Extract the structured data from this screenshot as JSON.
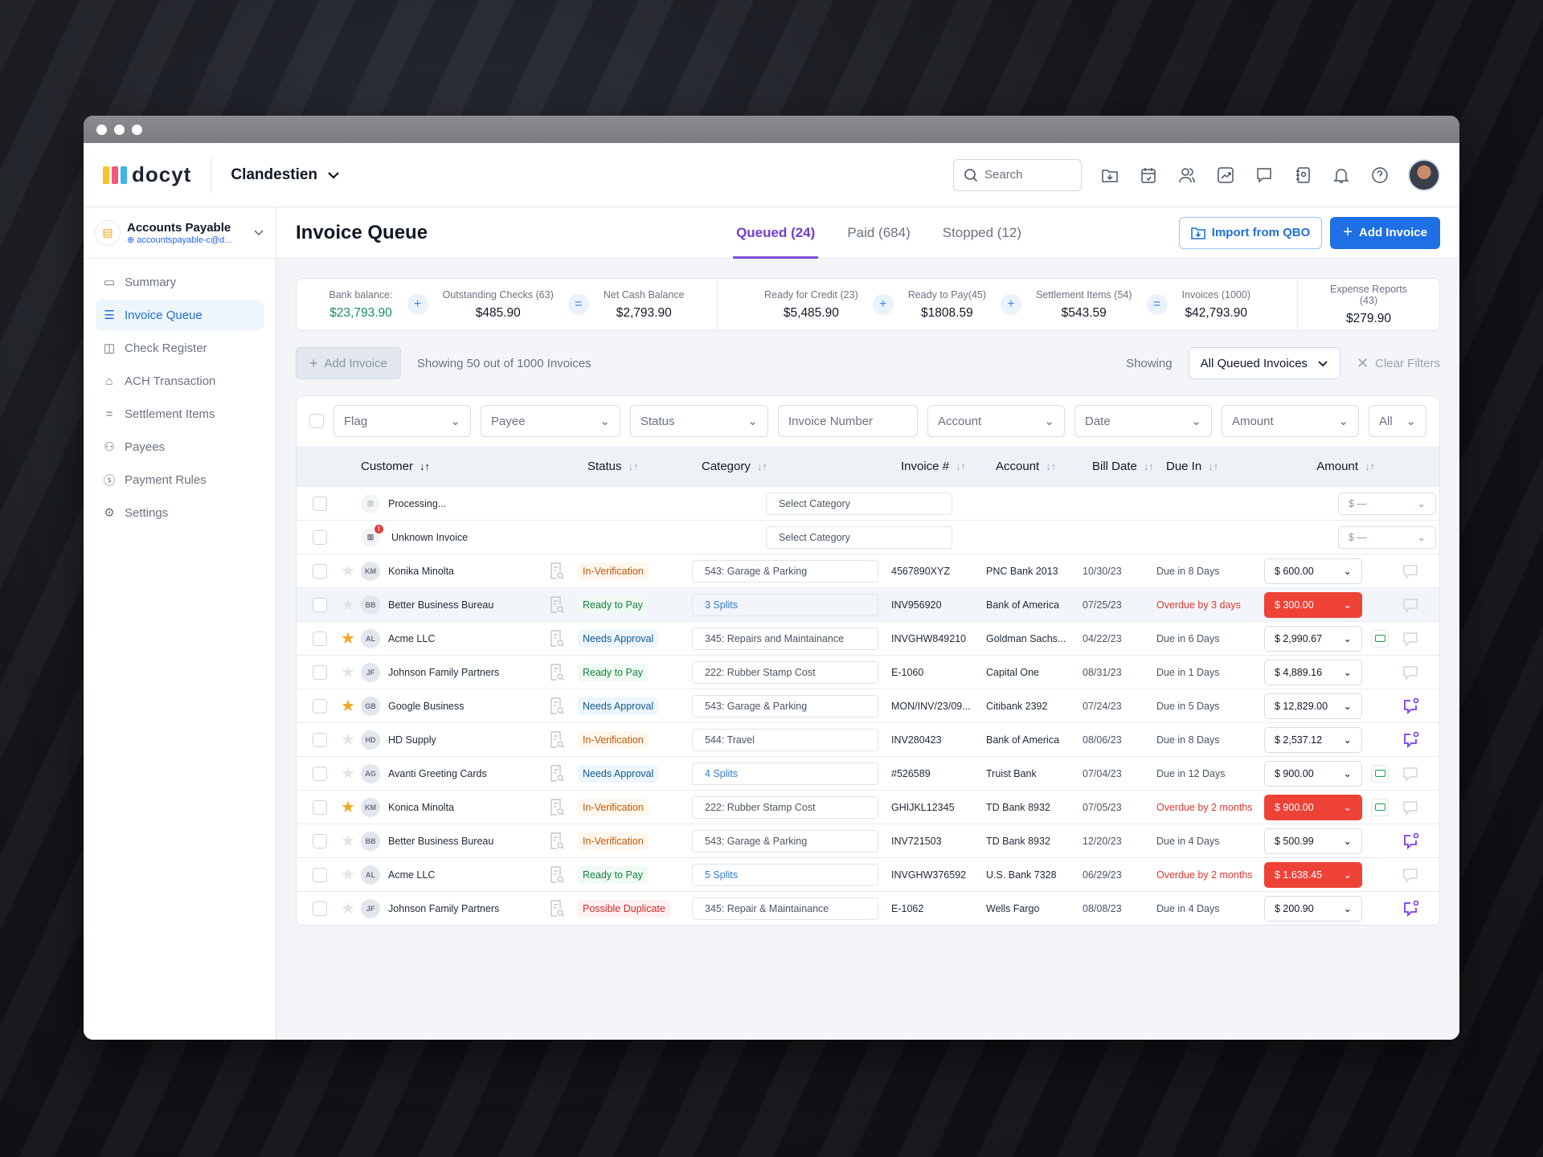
{
  "app": {
    "logo_text": "docyt",
    "company": "Clandestien",
    "search_placeholder": "Search"
  },
  "account": {
    "name": "Accounts Payable",
    "email": "accountspayable-c@d..."
  },
  "sidebar": {
    "items": [
      {
        "label": "Summary",
        "icon": "presentation-icon"
      },
      {
        "label": "Invoice Queue",
        "icon": "list-icon",
        "active": true
      },
      {
        "label": "Check Register",
        "icon": "book-icon"
      },
      {
        "label": "ACH Transaction",
        "icon": "bank-icon"
      },
      {
        "label": "Settlement Items",
        "icon": "equals-icon"
      },
      {
        "label": "Payees",
        "icon": "users-icon"
      },
      {
        "label": "Payment Rules",
        "icon": "dollar-circle-icon"
      },
      {
        "label": "Settings",
        "icon": "gear-icon"
      }
    ]
  },
  "header": {
    "title": "Invoice Queue",
    "tabs": [
      {
        "label": "Queued (24)",
        "active": true
      },
      {
        "label": "Paid (684)"
      },
      {
        "label": "Stopped (12)"
      }
    ],
    "import_label": "Import from QBO",
    "add_label": "Add Invoice"
  },
  "summary": {
    "bank_balance": {
      "label": "Bank balance:",
      "value": "$23,793.90"
    },
    "outstanding": {
      "label": "Outstanding Checks (63)",
      "value": "$485.90"
    },
    "net_cash": {
      "label": "Net Cash Balance",
      "value": "$2,793.90"
    },
    "ready_credit": {
      "label": "Ready for Credit (23)",
      "value": "$5,485.90"
    },
    "ready_pay": {
      "label": "Ready to Pay(45)",
      "value": "$1808.59"
    },
    "settlement": {
      "label": "Settlement Items (54)",
      "value": "$543.59"
    },
    "invoices": {
      "label": "Invoices (1000)",
      "value": "$42,793.90"
    },
    "expense": {
      "label": "Expense Reports (43)",
      "value": "$279.90"
    }
  },
  "toolbar": {
    "add_label": "Add Invoice",
    "showing_text": "Showing 50 out of 1000 Invoices",
    "showing_label": "Showing",
    "view_select": "All Queued Invoices",
    "clear_label": "Clear Filters"
  },
  "filters": {
    "flag": "Flag",
    "payee": "Payee",
    "status": "Status",
    "invoice_number": "Invoice Number",
    "account": "Account",
    "date": "Date",
    "amount": "Amount",
    "all": "All"
  },
  "columns": {
    "customer": "Customer",
    "status": "Status",
    "category": "Category",
    "invoice": "Invoice #",
    "account": "Account",
    "bill_date": "Bill Date",
    "due_in": "Due In",
    "amount": "Amount"
  },
  "pending_rows": [
    {
      "name": "Processing...",
      "category": "Select Category",
      "amount": "$ —"
    },
    {
      "name": "Unknown Invoice",
      "category": "Select Category",
      "amount": "$ —"
    }
  ],
  "rows": [
    {
      "starred": false,
      "initials": "KM",
      "name": "Konika Minolta",
      "status": "In-Verification",
      "category": "543: Garage & Parking",
      "invoice": "4567890XYZ",
      "account": "PNC Bank 2013",
      "bill_date": "10/30/23",
      "due": "Due in 8 Days",
      "overdue": false,
      "amount": "$ 600.00",
      "money": false,
      "chat": "empty"
    },
    {
      "starred": false,
      "initials": "BB",
      "name": "Better Business Bureau",
      "status": "Ready to Pay",
      "category": "3 Splits",
      "invoice": "INV956920",
      "account": "Bank of America",
      "bill_date": "07/25/23",
      "due": "Overdue by 3 days",
      "overdue": true,
      "amount": "$ 300.00",
      "money": false,
      "chat": "empty",
      "highlight": true
    },
    {
      "starred": true,
      "initials": "AL",
      "name": "Acme LLC",
      "status": "Needs Approval",
      "category": "345: Repairs and Maintainance",
      "invoice": "INVGHW849210",
      "account": "Goldman Sachs...",
      "bill_date": "04/22/23",
      "due": "Due in 6 Days",
      "overdue": false,
      "amount": "$ 2,990.67",
      "money": true,
      "chat": "empty"
    },
    {
      "starred": false,
      "initials": "JF",
      "name": "Johnson Family Partners",
      "status": "Ready to Pay",
      "category": "222: Rubber Stamp Cost",
      "invoice": "E-1060",
      "account": "Capital One",
      "bill_date": "08/31/23",
      "due": "Due in 1 Days",
      "overdue": false,
      "amount": "$ 4,889.16",
      "money": false,
      "chat": "empty"
    },
    {
      "starred": true,
      "initials": "GB",
      "name": "Google Business",
      "status": "Needs Approval",
      "category": "543: Garage & Parking",
      "invoice": "MON/INV/23/09...",
      "account": "Citibank 2392",
      "bill_date": "07/24/23",
      "due": "Due in 5 Days",
      "overdue": false,
      "amount": "$ 12,829.00",
      "money": false,
      "chat": "unread"
    },
    {
      "starred": false,
      "initials": "HD",
      "name": "HD Supply",
      "status": "In-Verification",
      "category": "544: Travel",
      "invoice": "INV280423",
      "account": "Bank of America",
      "bill_date": "08/06/23",
      "due": "Due in 8 Days",
      "overdue": false,
      "amount": "$ 2,537.12",
      "money": false,
      "chat": "unread"
    },
    {
      "starred": false,
      "initials": "AG",
      "name": "Avanti Greeting Cards",
      "status": "Needs Approval",
      "category": "4 Splits",
      "invoice": "#526589",
      "account": "Truist Bank",
      "bill_date": "07/04/23",
      "due": "Due in 12 Days",
      "overdue": false,
      "amount": "$ 900.00",
      "money": true,
      "chat": "empty"
    },
    {
      "starred": true,
      "initials": "KM",
      "name": "Konica Minolta",
      "status": "In-Verification",
      "category": "222: Rubber Stamp Cost",
      "invoice": "GHIJKL12345",
      "account": "TD Bank 8932",
      "bill_date": "07/05/23",
      "due": "Overdue by 2 months",
      "overdue": true,
      "amount": "$ 900.00",
      "money": true,
      "chat": "empty"
    },
    {
      "starred": false,
      "initials": "BB",
      "name": "Better Business Bureau",
      "status": "In-Verification",
      "category": "543: Garage & Parking",
      "invoice": "INV721503",
      "account": "TD Bank 8932",
      "bill_date": "12/20/23",
      "due": "Due in 4 Days",
      "overdue": false,
      "amount": "$ 500.99",
      "money": false,
      "chat": "unread"
    },
    {
      "starred": false,
      "initials": "AL",
      "name": "Acme LLC",
      "status": "Ready to Pay",
      "category": "5 Splits",
      "invoice": "INVGHW376592",
      "account": "U.S. Bank 7328",
      "bill_date": "06/29/23",
      "due": "Overdue by 2 months",
      "overdue": true,
      "amount": "$ 1.638.45",
      "money": false,
      "chat": "empty"
    },
    {
      "starred": false,
      "initials": "JF",
      "name": "Johnson Family Partners",
      "status": "Possible Duplicate",
      "category": "345: Repair & Maintainance",
      "invoice": "E-1062",
      "account": "Wells Fargo",
      "bill_date": "08/08/23",
      "due": "Due in 4 Days",
      "overdue": false,
      "amount": "$ 200.90",
      "money": false,
      "chat": "unread"
    }
  ],
  "colors": {
    "primary": "#1f6fe5",
    "active_tab": "#6d3fd1",
    "overdue": "#ee4237",
    "positive": "#16905c"
  }
}
